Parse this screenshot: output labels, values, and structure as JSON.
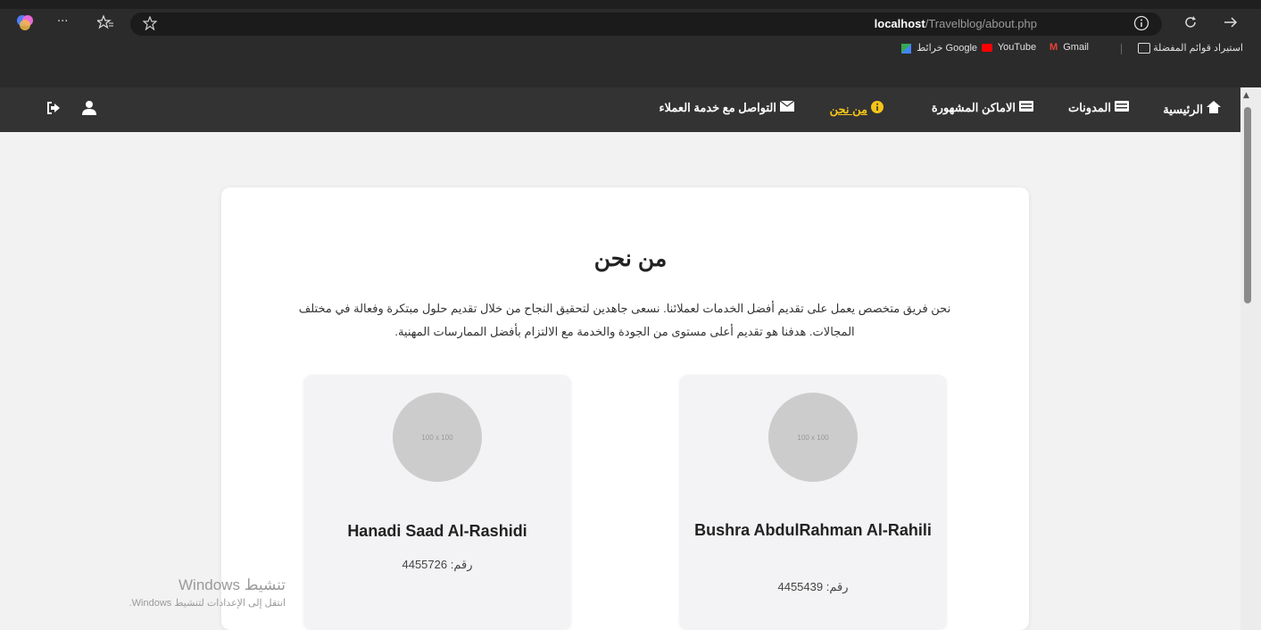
{
  "browser": {
    "url_host": "localhost",
    "url_path": "/Travelblog/about.php",
    "menu_dots": "···"
  },
  "bookmarks": [
    {
      "label": "استيراد قوائم المفضلة"
    },
    {
      "label": "Gmail"
    },
    {
      "label": "YouTube"
    },
    {
      "label": "خرائط Google"
    }
  ],
  "nav": {
    "items": [
      {
        "label": "الرئيسية",
        "icon": "home-icon"
      },
      {
        "label": "المدونات",
        "icon": "list-icon"
      },
      {
        "label": "الاماكن المشهورة",
        "icon": "list-icon"
      },
      {
        "label": "من نحن",
        "icon": "info-icon",
        "active": true
      },
      {
        "label": "التواصل مع خدمة العملاء",
        "icon": "envelope-icon"
      }
    ],
    "accent_color": "#f5c518"
  },
  "page": {
    "title": "من نحن",
    "intro_line1": "نحن فريق متخصص يعمل على تقديم أفضل الخدمات لعملائنا. نسعى جاهدين لتحقيق النجاح من خلال تقديم حلول مبتكرة وفعالة في مختلف",
    "intro_line2": "المجالات. هدفنا هو تقديم أعلى مستوى من الجودة والخدمة مع الالتزام بأفضل الممارسات المهنية."
  },
  "members": [
    {
      "avatar_text": "100 x 100",
      "name": "Bushra AbdulRahman Al-Rahili",
      "number_label": "رقم:",
      "number": "4455439"
    },
    {
      "avatar_text": "100 x 100",
      "name": "Hanadi Saad Al-Rashidi",
      "number_label": "رقم:",
      "number": "4455726"
    }
  ],
  "watermark": {
    "title": "تنشيط Windows",
    "subtitle": "انتقل إلى الإعدادات لتنشيط Windows."
  }
}
